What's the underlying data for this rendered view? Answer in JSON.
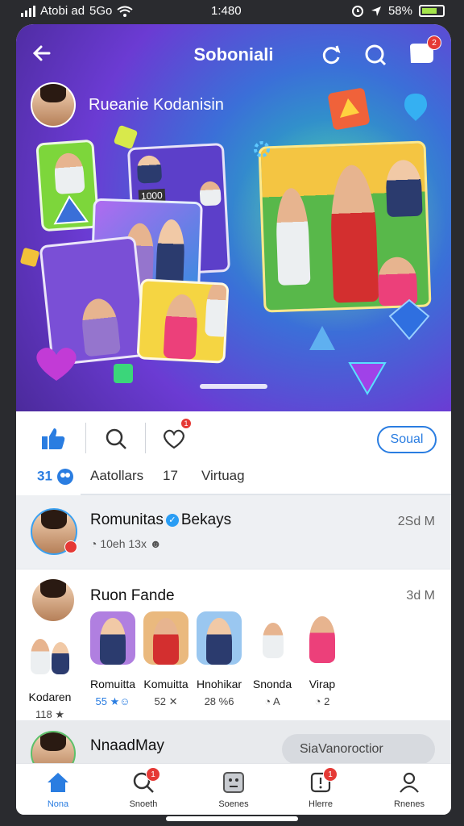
{
  "status_bar": {
    "carrier": "Atobi ad",
    "network": "5Go",
    "time": "1:480",
    "battery": "58%"
  },
  "header": {
    "title": "Soboniali",
    "notification_count": "2"
  },
  "hero": {
    "profile_name": "Rueanie Kodanisin",
    "card_label": "1000"
  },
  "actions": {
    "heart_badge": "1",
    "social_button": "Soual",
    "tabs": {
      "count": "31",
      "label1": "Aatollars",
      "number": "17",
      "label2": "Virtuag"
    }
  },
  "feed": [
    {
      "title": "Romunitas",
      "title2": "Bekays",
      "subtitle": "10eh 13x",
      "time": "2Sd M"
    },
    {
      "title": "Ruon Fande",
      "time": "3d M"
    },
    {
      "title": "NnaadMay",
      "button": "SiaVanoroctior"
    }
  ],
  "stories": [
    {
      "name": "Kodaren",
      "stat": "118"
    },
    {
      "name": "Romuitta",
      "stat": "55"
    },
    {
      "name": "Komuitta",
      "stat": "52"
    },
    {
      "name": "Hnohikar",
      "stat": "28 %6"
    },
    {
      "name": "Snonda",
      "stat": "A"
    },
    {
      "name": "Virap",
      "stat": "2"
    }
  ],
  "bottom_nav": [
    {
      "label": "Nona",
      "icon": "home-icon"
    },
    {
      "label": "Snoeth",
      "icon": "search-icon",
      "badge": "1"
    },
    {
      "label": "Soenes",
      "icon": "scenes-icon"
    },
    {
      "label": "Hlerre",
      "icon": "alerts-icon",
      "badge": "1"
    },
    {
      "label": "Rnenes",
      "icon": "profile-icon"
    }
  ],
  "colors": {
    "accent": "#2a7de1",
    "badge": "#e53935",
    "hero_start": "#6b3bd3",
    "hero_mid": "#3b6fd8",
    "hero_glow": "#23c0b8"
  }
}
